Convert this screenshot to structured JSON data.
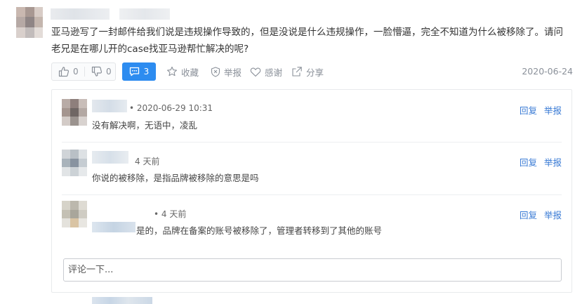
{
  "post": {
    "text": "亚马逊写了一封邮件给我们说是违规操作导致的，但是没说是什么违规操作，一脸懵逼，完全不知道为什么被移除了。请问老兄是在哪儿开的case找亚马逊帮忙解决的呢?",
    "date": "2020-06-24"
  },
  "actions": {
    "upvote_count": "0",
    "downvote_count": "0",
    "comment_count": "3",
    "favorite_label": "收藏",
    "report_label": "举报",
    "thanks_label": "感谢",
    "share_label": "分享"
  },
  "comments": [
    {
      "meta": "• 2020-06-29 10:31",
      "text": "没有解决啊，无语中，凌乱",
      "reply_label": "回复",
      "report_label": "举报"
    },
    {
      "meta": "4 天前",
      "text": "你说的被移除，是指品牌被移除的意思是吗",
      "reply_label": "回复",
      "report_label": "举报"
    },
    {
      "meta": "• 4 天前",
      "text": "是的，品牌在备案的账号被移除了，管理者转移到了其他的账号",
      "reply_label": "回复",
      "report_label": "举报"
    }
  ],
  "comment_input": {
    "placeholder": "评论一下..."
  },
  "colors": {
    "accent": "#2d8cf0",
    "link": "#3a7bd5",
    "muted": "#8a9099"
  }
}
